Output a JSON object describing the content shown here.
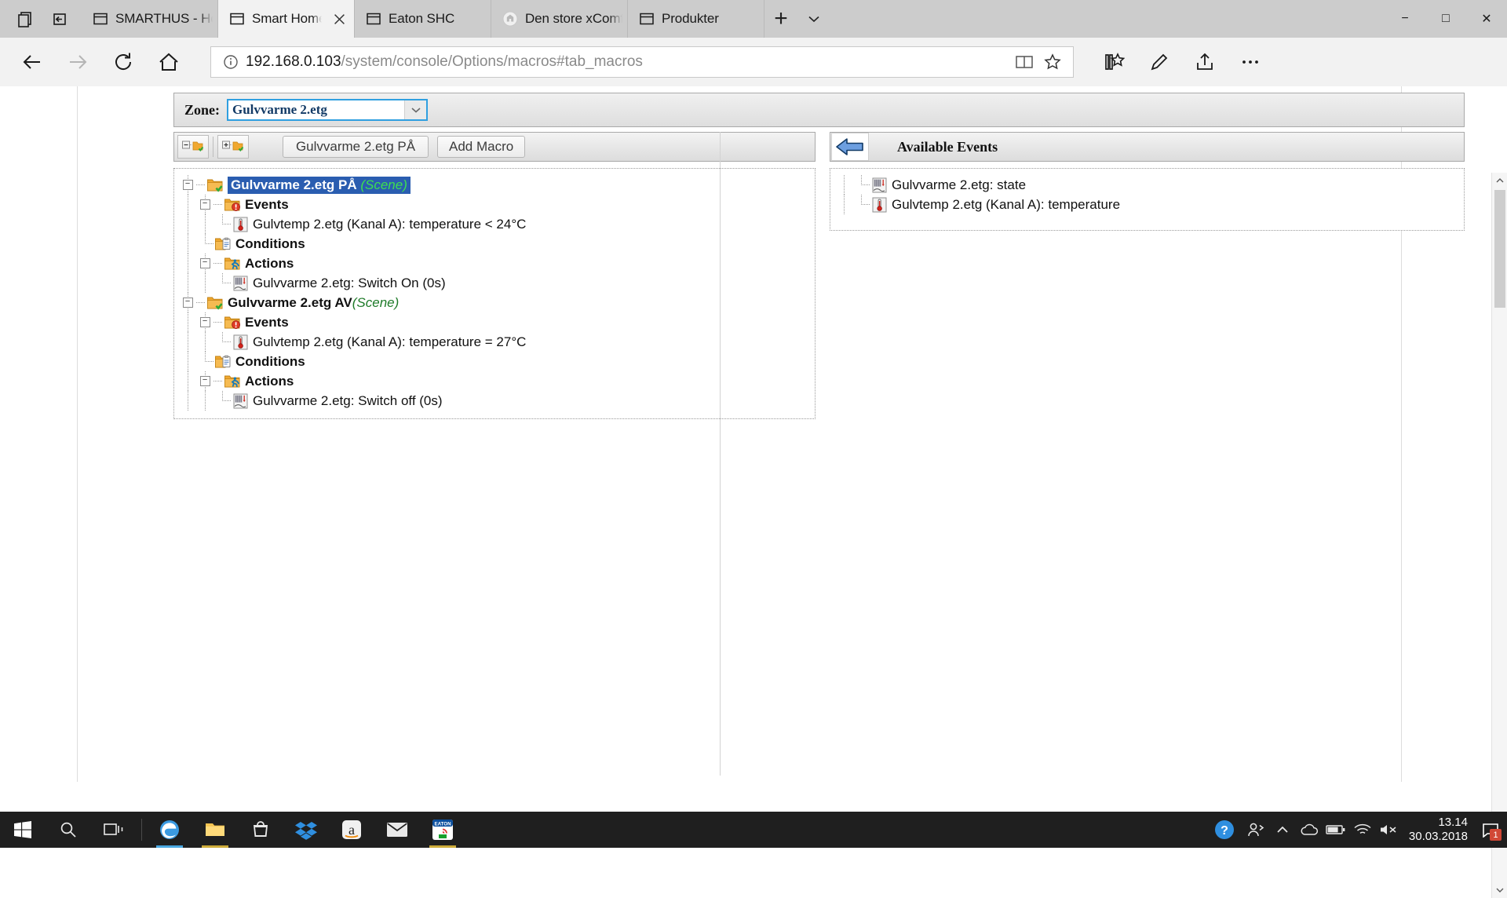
{
  "browser": {
    "tabs": [
      {
        "title": "SMARTHUS - Home Auton",
        "icon": "window-icon",
        "active": false,
        "closable": false
      },
      {
        "title": "Smart Home Controlle",
        "icon": "window-icon",
        "active": true,
        "closable": true
      },
      {
        "title": "Eaton SHC",
        "icon": "window-icon",
        "active": false,
        "closable": false
      },
      {
        "title": "Den store xComfort-Sensi",
        "icon": "home-shield-icon",
        "active": false,
        "closable": false
      },
      {
        "title": "Produkter",
        "icon": "window-icon",
        "active": false,
        "closable": false
      }
    ],
    "new_tab_label": "+",
    "tab_list_icon": "chevron-down-icon",
    "task_view_icon": "task-view-icon",
    "set_aside_icon": "set-tabs-aside-icon",
    "window_controls": {
      "minimize": "−",
      "maximize": "□",
      "close": "✕"
    },
    "nav": {
      "back_icon": "back-arrow-icon",
      "forward_icon": "forward-arrow-icon",
      "refresh_icon": "refresh-icon",
      "home_icon": "home-icon",
      "reading_view_icon": "reading-view-icon",
      "favorite_icon": "star-icon",
      "hub_icon": "hub-favorites-icon",
      "notes_icon": "make-a-note-icon",
      "share_icon": "share-icon",
      "more_icon": "more-options-icon"
    },
    "address": {
      "info_icon": "info-icon",
      "host": "192.168.0.103",
      "path": "/system/console/Options/macros#tab_macros"
    }
  },
  "page": {
    "zone": {
      "label": "Zone:",
      "selected": "Gulvvarme 2.etg",
      "dropdown_icon": "chevron-down-icon"
    },
    "left_toolbar": {
      "collapse_all_icon": "collapse-all-folder-icon",
      "expand_all_icon": "expand-all-folder-icon",
      "macro_button": "Gulvvarme 2.etg PÅ",
      "add_macro_button": "Add Macro"
    },
    "right_panel": {
      "back_icon": "blue-left-arrow-icon",
      "title": "Available Events",
      "items": [
        {
          "label": "Gulvvarme 2.etg: state",
          "icon": "actuator-icon"
        },
        {
          "label": "Gulvtemp 2.etg (Kanal A): temperature",
          "icon": "thermometer-icon"
        }
      ]
    },
    "macro_tree": [
      {
        "label": "Gulvvarme 2.etg PÅ",
        "tag": "(Scene)",
        "icon": "scene-folder-icon",
        "selected": true,
        "expanded": true,
        "groups": [
          {
            "label": "Events",
            "icon": "events-folder-icon",
            "expanded": true,
            "children": [
              {
                "label": "Gulvtemp 2.etg (Kanal A): temperature < 24°C",
                "icon": "thermometer-icon"
              }
            ]
          },
          {
            "label": "Conditions",
            "icon": "conditions-clipboard-icon",
            "expanded": null,
            "children": []
          },
          {
            "label": "Actions",
            "icon": "actions-runner-icon",
            "expanded": true,
            "children": [
              {
                "label": "Gulvvarme 2.etg: Switch On (0s)",
                "icon": "actuator-icon"
              }
            ]
          }
        ]
      },
      {
        "label": "Gulvvarme 2.etg AV",
        "tag": "(Scene)",
        "icon": "scene-folder-icon",
        "selected": false,
        "expanded": true,
        "groups": [
          {
            "label": "Events",
            "icon": "events-folder-icon",
            "expanded": true,
            "children": [
              {
                "label": "Gulvtemp 2.etg (Kanal A): temperature = 27°C",
                "icon": "thermometer-icon"
              }
            ]
          },
          {
            "label": "Conditions",
            "icon": "conditions-clipboard-icon",
            "expanded": null,
            "children": []
          },
          {
            "label": "Actions",
            "icon": "actions-runner-icon",
            "expanded": true,
            "children": [
              {
                "label": "Gulvvarme 2.etg: Switch off (0s)",
                "icon": "actuator-icon"
              }
            ]
          }
        ]
      }
    ]
  },
  "taskbar": {
    "start_icon": "windows-start-icon",
    "search_icon": "search-icon",
    "task_view_icon": "task-view-icon",
    "apps": [
      {
        "name": "edge-icon",
        "open": true
      },
      {
        "name": "file-explorer-icon",
        "open": true
      },
      {
        "name": "microsoft-store-icon",
        "open": false
      },
      {
        "name": "dropbox-icon",
        "open": false
      },
      {
        "name": "amazon-icon",
        "open": false
      },
      {
        "name": "mail-icon",
        "open": false
      },
      {
        "name": "eaton-shc-icon",
        "open": true
      }
    ],
    "tray": {
      "help_icon": "help-circle-icon",
      "people_icon": "people-icon",
      "show_hidden_icon": "chevron-up-icon",
      "onedrive_icon": "cloud-icon",
      "battery_icon": "battery-icon",
      "network_icon": "wifi-icon",
      "volume_icon": "volume-mute-icon"
    },
    "clock": {
      "time": "13.14",
      "date": "30.03.2018"
    },
    "notification": {
      "icon": "notification-icon",
      "count": "1"
    }
  },
  "colors": {
    "accent_blue": "#2a5db0",
    "focus_blue": "#2f9fe0",
    "scene_green": "#1d7a28",
    "chrome_gray": "#cccccc",
    "taskbar": "#1f1f1f"
  }
}
